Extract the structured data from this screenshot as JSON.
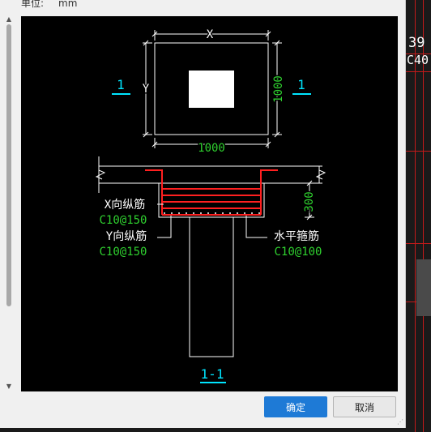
{
  "dialog": {
    "unit_label": "单位:",
    "unit_value": "mm",
    "ok_label": "确定",
    "cancel_label": "取消"
  },
  "drawing": {
    "plan_x_label": "X",
    "plan_y_label": "Y",
    "plan_width": "1000",
    "plan_height": "1000",
    "section_mark_left": "1",
    "section_mark_right": "1",
    "depth_label": "300",
    "x_rebar_label": "X向纵筋",
    "x_rebar_spec": "C10@150",
    "y_rebar_label": "Y向纵筋",
    "y_rebar_spec": "C10@150",
    "stirrup_label": "水平箍筋",
    "stirrup_spec": "C10@100",
    "section_title": "1-1"
  },
  "background": {
    "numbers": [
      "39",
      "C40"
    ]
  },
  "colors": {
    "accent": "#1e7ad6",
    "cad_green": "#2fd12f",
    "cad_red": "#ff2020",
    "cad_cyan": "#00e5ff",
    "cad_white": "#ffffff"
  }
}
